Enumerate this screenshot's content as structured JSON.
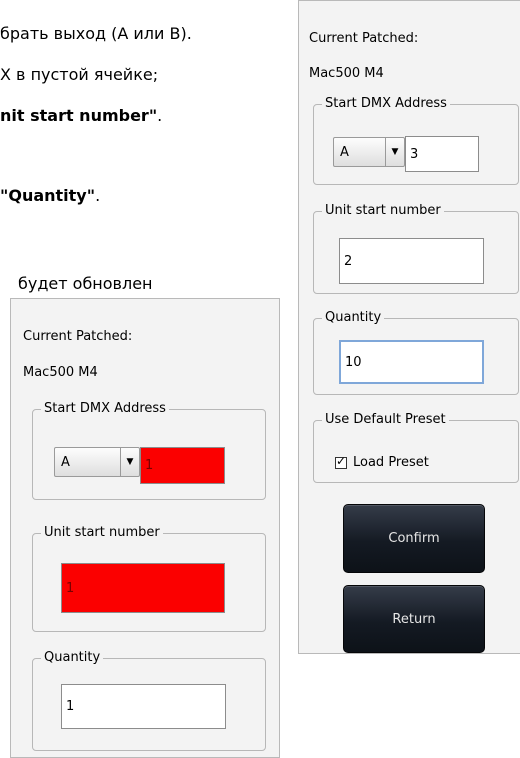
{
  "document": {
    "line1": "брать выход (А или В).",
    "line2": "Х в пустой ячейке;",
    "line3_bold": "nit start number\"",
    "line3_end": ".",
    "line4_bold": "\"Quantity\"",
    "line4_end": ".",
    "line5": "будет обновлен"
  },
  "dialog_left": {
    "current_patched_label": "Current Patched:",
    "fixture_name": "Mac500 M4",
    "start_dmx_legend": "Start DMX Address",
    "port_value": "A",
    "address_value": "1",
    "unit_start_legend": "Unit start number",
    "unit_start_value": "1",
    "quantity_legend": "Quantity",
    "quantity_value": "1"
  },
  "dialog_right": {
    "current_patched_label": "Current Patched:",
    "fixture_name": "Mac500 M4",
    "start_dmx_legend": "Start DMX Address",
    "port_value": "A",
    "address_value": "3",
    "unit_start_legend": "Unit start number",
    "unit_start_value": "2",
    "quantity_legend": "Quantity",
    "quantity_value": "10",
    "default_preset_legend": "Use Default Preset",
    "load_preset_label": "Load Preset",
    "load_preset_checked": true,
    "confirm_label": "Confirm",
    "return_label": "Return"
  },
  "colors": {
    "error_field": "#fb0000",
    "panel_bg": "#f3f3f3",
    "button_dark": "#141a23",
    "focus_border": "#7fa7d9"
  }
}
